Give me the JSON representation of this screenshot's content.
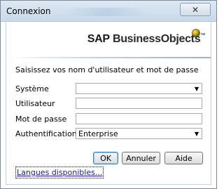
{
  "window": {
    "title": "Connexion",
    "close_glyph": "✕"
  },
  "logo": {
    "sap": "SAP",
    "business": "Business",
    "objects": "Objects",
    "trademark": "™",
    "icon": "globe-logo-icon"
  },
  "form": {
    "subtitle": "Saisissez vos nom d'utilisateur et mot de passe",
    "system": {
      "label": "Système",
      "value": ""
    },
    "user": {
      "label": "Utilisateur",
      "value": ""
    },
    "password": {
      "label": "Mot de passe",
      "value": ""
    },
    "auth": {
      "label": "Authentification",
      "value": "Enterprise"
    }
  },
  "buttons": {
    "ok": "OK",
    "cancel": "Annuler",
    "help": "Aide"
  },
  "links": {
    "languages": "Langues disponibles..."
  },
  "colors": {
    "titlebar": "#c9d9ea",
    "link": "#1a1a9a"
  }
}
